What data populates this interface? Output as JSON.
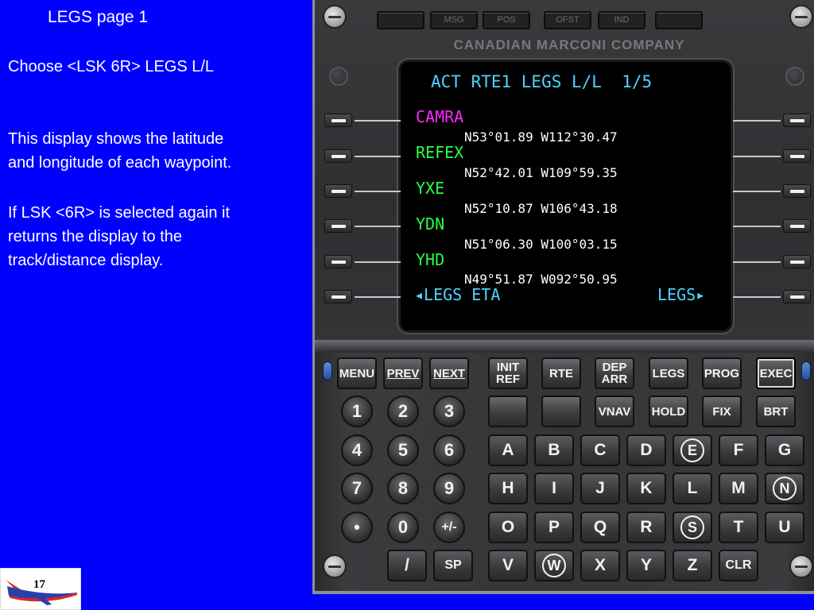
{
  "slide": {
    "title": "LEGS page 1",
    "para1": "Choose <LSK 6R> LEGS L/L",
    "para2": "This display shows the latitude\nand longitude of each waypoint.",
    "para3": "If LSK <6R> is selected again it\nreturns the display to the\ntrack/distance display.",
    "page_number": "17"
  },
  "cdu": {
    "maker": "CANADIAN MARCONI COMPANY",
    "annunciators": [
      "MSG",
      "POS",
      "OFST",
      "IND"
    ],
    "screen": {
      "title": "ACT RTE1 LEGS L/L  1/5",
      "legs": [
        {
          "name": "CAMRA",
          "coords": "N53°01.89 W112°30.47",
          "color": "magenta"
        },
        {
          "name": "REFEX",
          "coords": "N52°42.01 W109°59.35",
          "color": "green"
        },
        {
          "name": "YXE",
          "coords": "N52°10.87 W106°43.18",
          "color": "green"
        },
        {
          "name": "YDN",
          "coords": "N51°06.30 W100°03.15",
          "color": "green"
        },
        {
          "name": "YHD",
          "coords": "N49°51.87 W092°50.95",
          "color": "green"
        }
      ],
      "lsk6_left": "◂LEGS ETA",
      "lsk6_right": "LEGS▸"
    },
    "function_keys_row1": [
      "MENU",
      "PREV",
      "NEXT",
      "INIT\nREF",
      "RTE",
      "DEP\nARR",
      "LEGS",
      "PROG",
      "EXEC"
    ],
    "function_keys_row2": [
      "",
      "",
      "VNAV",
      "HOLD",
      "FIX",
      "BRT"
    ],
    "numeric_keys": [
      "1",
      "2",
      "3",
      "4",
      "5",
      "6",
      "7",
      "8",
      "9",
      "•",
      "0",
      "+/-"
    ],
    "alpha_keys": [
      [
        "A",
        "B",
        "C",
        "D",
        "E",
        "F",
        "G"
      ],
      [
        "H",
        "I",
        "J",
        "K",
        "L",
        "M",
        "N"
      ],
      [
        "O",
        "P",
        "Q",
        "R",
        "S",
        "T",
        "U"
      ]
    ],
    "bottom_keys": [
      "/",
      "SP",
      "V",
      "W",
      "X",
      "Y",
      "Z",
      "CLR"
    ]
  }
}
